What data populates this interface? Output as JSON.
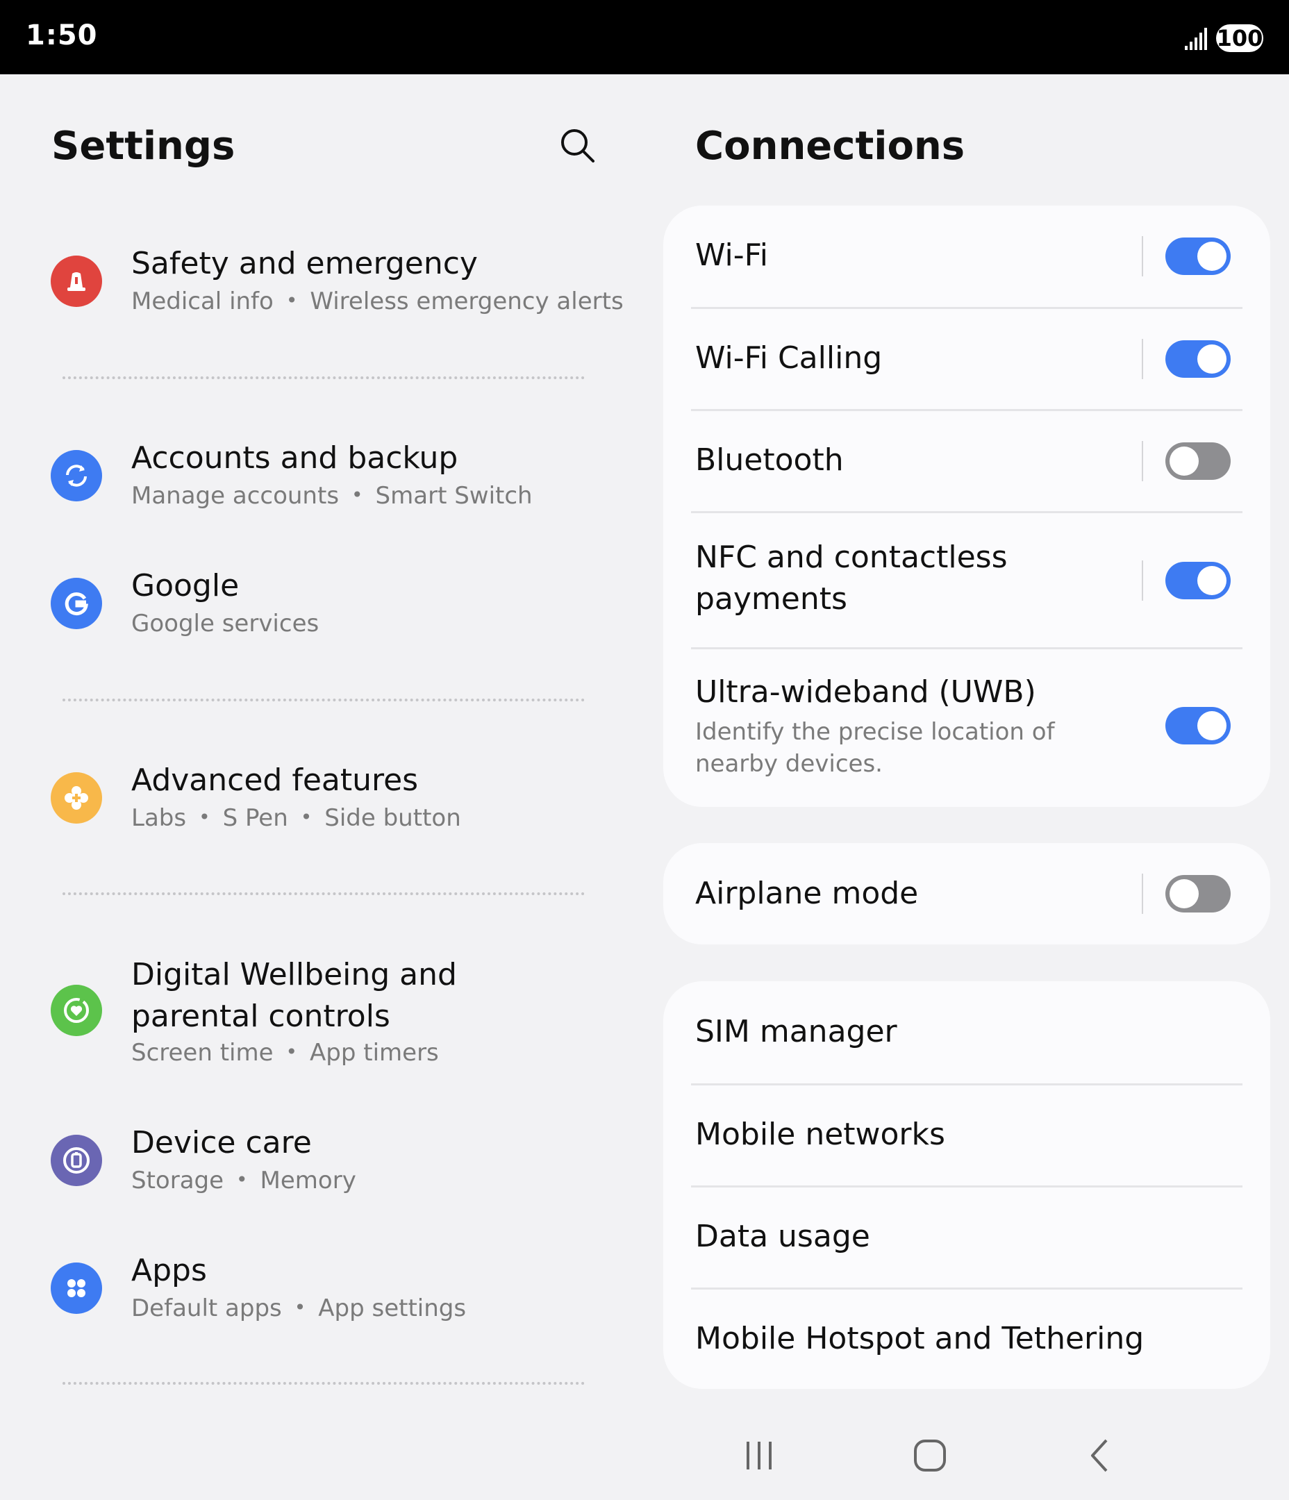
{
  "status_bar": {
    "time": "1:50",
    "battery": "100"
  },
  "left": {
    "title": "Settings",
    "items": [
      {
        "title": "Safety and emergency",
        "subs": [
          "Medical info",
          "Wireless emergency alerts"
        ],
        "icon": "siren-icon",
        "color": "#e0443e"
      },
      {
        "title": "Accounts and backup",
        "subs": [
          "Manage accounts",
          "Smart Switch"
        ],
        "icon": "sync-icon",
        "color": "#3e7bf2"
      },
      {
        "title": "Google",
        "subs": [
          "Google services"
        ],
        "icon": "google-icon",
        "color": "#3e7bf2"
      },
      {
        "title": "Advanced features",
        "subs": [
          "Labs",
          "S Pen",
          "Side button"
        ],
        "icon": "plus-gear-icon",
        "color": "#f8b84a"
      },
      {
        "title": "Digital Wellbeing and parental controls",
        "subs": [
          "Screen time",
          "App timers"
        ],
        "icon": "heart-circle-icon",
        "color": "#5cc34b"
      },
      {
        "title": "Device care",
        "subs": [
          "Storage",
          "Memory"
        ],
        "icon": "device-care-icon",
        "color": "#6a66b3"
      },
      {
        "title": "Apps",
        "subs": [
          "Default apps",
          "App settings"
        ],
        "icon": "apps-grid-icon",
        "color": "#3e7bf2"
      }
    ]
  },
  "right": {
    "title": "Connections",
    "group1": [
      {
        "label": "Wi-Fi",
        "toggle": true
      },
      {
        "label": "Wi-Fi Calling",
        "toggle": true
      },
      {
        "label": "Bluetooth",
        "toggle": false
      },
      {
        "label": "NFC and contactless payments",
        "toggle": true
      },
      {
        "label": "Ultra-wideband (UWB)",
        "sub": "Identify the precise location of nearby devices.",
        "toggle": true
      }
    ],
    "group2": [
      {
        "label": "Airplane mode",
        "toggle": false
      }
    ],
    "group3": [
      {
        "label": "SIM manager"
      },
      {
        "label": "Mobile networks"
      },
      {
        "label": "Data usage"
      },
      {
        "label": "Mobile Hotspot and Tethering"
      }
    ]
  },
  "colors": {
    "accent": "#3e7bf2",
    "toggle_off": "#8e8e91",
    "background": "#f2f2f4",
    "card": "#fbfbfd"
  }
}
